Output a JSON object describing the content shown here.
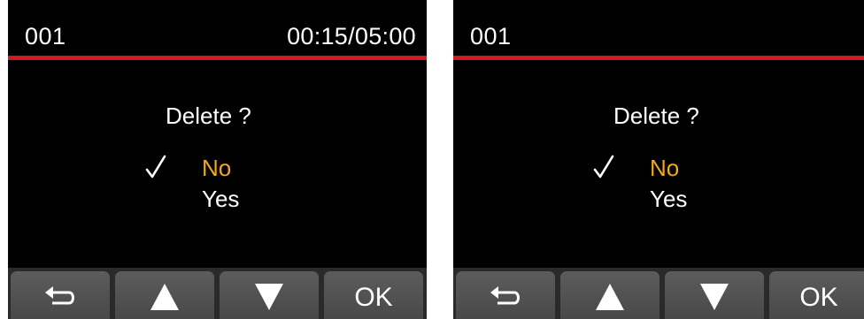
{
  "screens": [
    {
      "file_number": "001",
      "time": "00:15/05:00",
      "dialog": {
        "title": "Delete ?",
        "options": [
          "No",
          "Yes"
        ],
        "selected": "No"
      },
      "buttons": {
        "back_icon": "return-arrow-icon",
        "up_icon": "triangle-up-icon",
        "down_icon": "triangle-down-icon",
        "ok_label": "OK"
      }
    },
    {
      "file_number": "001",
      "time": "",
      "dialog": {
        "title": "Delete ?",
        "options": [
          "No",
          "Yes"
        ],
        "selected": "No"
      },
      "buttons": {
        "back_icon": "return-arrow-icon",
        "up_icon": "triangle-up-icon",
        "down_icon": "triangle-down-icon",
        "ok_label": "OK"
      }
    }
  ],
  "colors": {
    "background": "#000000",
    "accent_line": "#d01a1f",
    "selected_option": "#f0a81c",
    "text": "#ffffff",
    "button": "#4f4f4f"
  }
}
